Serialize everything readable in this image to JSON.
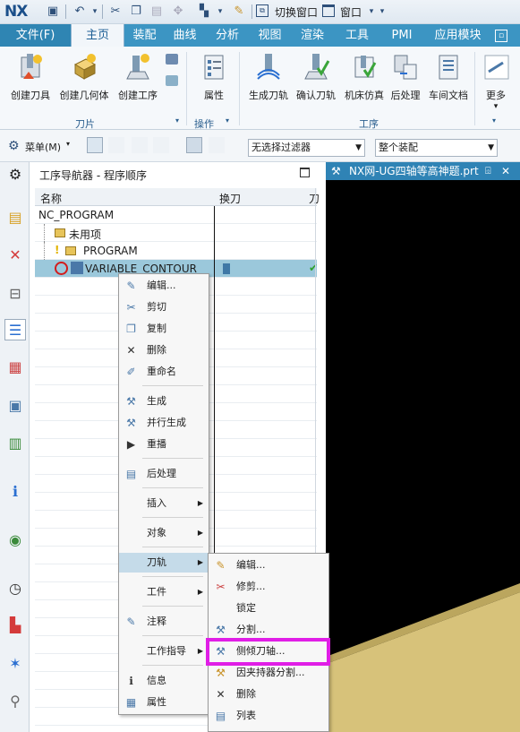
{
  "app": {
    "logo": "NX",
    "quick": [
      "save-icon",
      "undo-icon",
      "redo-dropdown-icon",
      "cut-icon",
      "copy-icon",
      "paste-icon",
      "snap-icon",
      "selection-icon",
      "brush-icon"
    ],
    "switch_window": "切换窗口",
    "window_menu": "窗口"
  },
  "menubar": {
    "tabs": [
      "文件(F)",
      "主页",
      "装配",
      "曲线",
      "分析",
      "视图",
      "渲染",
      "工具",
      "PMI",
      "应用模块"
    ],
    "active": "主页"
  },
  "ribbon": {
    "buttons": [
      "创建刀具",
      "创建几何体",
      "创建工序",
      "属性",
      "生成刀轨",
      "确认刀轨",
      "机床仿真",
      "后处理",
      "车间文档",
      "更多"
    ],
    "groups": [
      "刀片",
      "操作",
      "工序"
    ]
  },
  "toolbar2": {
    "menu_label": "菜单(M)",
    "filter": "无选择过滤器",
    "assembly": "整个装配"
  },
  "navigator": {
    "title": "工序导航器 - 程序顺序",
    "columns": [
      "名称",
      "换刀",
      "刀"
    ],
    "rows": [
      "NC_PROGRAM",
      "未用项",
      "PROGRAM",
      "VARIABLE_CONTOUR"
    ]
  },
  "viewport": {
    "tab": "NX网-UG四轴等高神题.prt"
  },
  "context_menu": {
    "items": [
      "编辑...",
      "剪切",
      "复制",
      "删除",
      "重命名",
      "生成",
      "并行生成",
      "重播",
      "后处理",
      "插入",
      "对象",
      "刀轨",
      "工件",
      "注释",
      "工作指导",
      "信息",
      "属性"
    ]
  },
  "submenu": {
    "items": [
      "编辑...",
      "修剪...",
      "锁定",
      "分割...",
      "侧倾刀轴...",
      "因夹持器分割...",
      "删除",
      "列表"
    ]
  },
  "colors": {
    "menubar": "#3c95c3",
    "highlight": "#e01ee6",
    "selection": "#9bc8db",
    "floor": "#d7c27a"
  }
}
